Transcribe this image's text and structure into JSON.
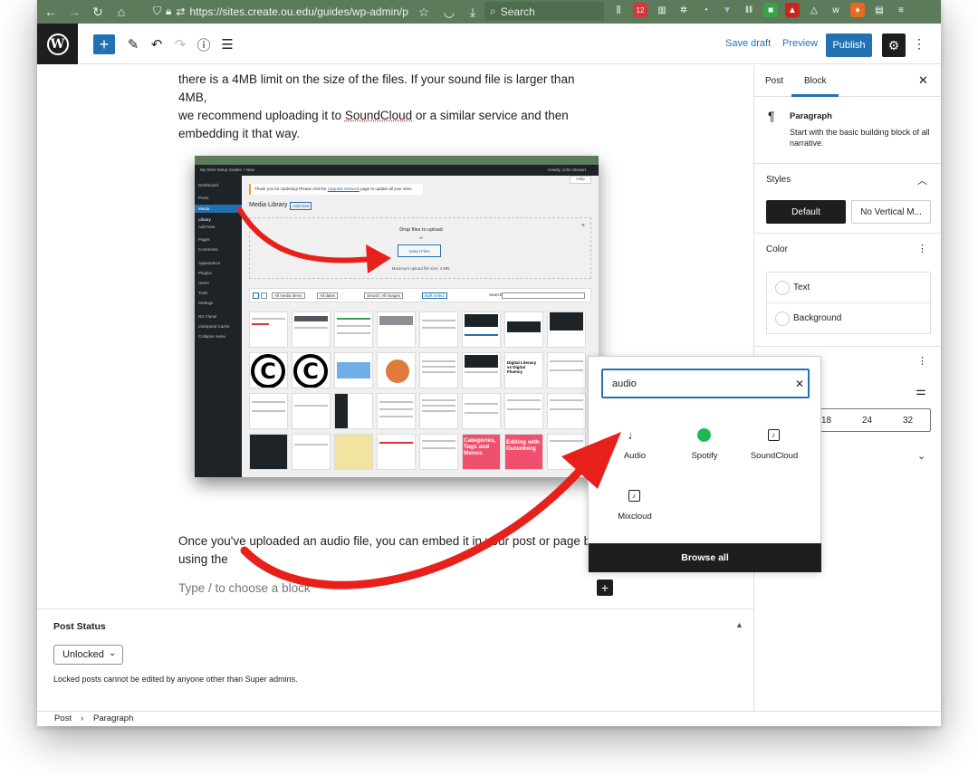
{
  "browser": {
    "url": "https://sites.create.ou.edu/guides/wp-admin/p",
    "search_placeholder": "Search",
    "badge_count": "12"
  },
  "toolbar": {
    "save_draft": "Save draft",
    "preview": "Preview",
    "publish": "Publish"
  },
  "editor": {
    "intro_line1": "there is a 4MB limit on the size of the files. If your sound file is larger than 4MB,",
    "intro_line2_pre": "we recommend uploading it to ",
    "intro_link": "SoundCloud",
    "intro_line2_post": " or a similar service and then",
    "intro_line3": "embedding it that way.",
    "embed_line1": "Once you've uploaded an audio file, you can embed it in your post or page by",
    "embed_line2": "using the",
    "placeholder": "Type / to choose a block"
  },
  "screenshot": {
    "menu": [
      "Dashboard",
      "Posts",
      "Media",
      "Library",
      "Add New",
      "Pages",
      "Comments",
      "Appearance",
      "Plugins",
      "Users",
      "Tools",
      "Settings",
      "NS Cloner",
      "LiteSpeed Cache",
      "Collapse menu"
    ],
    "admin_bar": "My Sites   Setup Guides   + New",
    "howdy": "Howdy, John Stewart",
    "notice_pre": "Thank you for Updating! Please visit the ",
    "notice_link": "Upgrade Network",
    "notice_post": " page to update all your sites.",
    "title": "Media Library",
    "add_new": "Add New",
    "help": "Help",
    "drop_title": "Drop files to upload",
    "drop_or": "or",
    "select_files": "Select Files",
    "max_size": "Maximum upload file size: 4 MB.",
    "filter_items": "All media items",
    "filter_dates": "All dates",
    "filter_smush": "Smush: All images",
    "bulk_select": "Bulk select",
    "search_label": "Search",
    "tile_text_1": "Categories, Tags and Menus",
    "tile_text_2": "Editing with Gutenberg",
    "tile_text_3": "Digital Literacy vs Digital Fluency"
  },
  "post_status": {
    "title": "Post Status",
    "lock_value": "Unlocked",
    "help": "Locked posts cannot be edited by anyone other than Super admins."
  },
  "breadcrumb": {
    "root": "Post",
    "separator": "›",
    "current": "Paragraph"
  },
  "sidebar": {
    "tab_post": "Post",
    "tab_block": "Block",
    "block_name": "Paragraph",
    "block_desc": "Start with the basic building block of all narrative.",
    "styles_title": "Styles",
    "style_default": "Default",
    "style_novertical": "No Vertical M...",
    "color_title": "Color",
    "color_text": "Text",
    "color_background": "Background",
    "font_sizes": [
      "18",
      "24",
      "32"
    ]
  },
  "inserter": {
    "search_value": "audio",
    "items": [
      {
        "label": "Audio",
        "icon": "audio-note-icon"
      },
      {
        "label": "Spotify",
        "icon": "spotify-icon"
      },
      {
        "label": "SoundCloud",
        "icon": "soundcloud-icon"
      },
      {
        "label": "Mixcloud",
        "icon": "mixcloud-icon"
      }
    ],
    "browse_all": "Browse all"
  },
  "colors": {
    "accent": "#2271b1",
    "dark": "#1e1e1e",
    "browser_green": "#5b7b5b",
    "annotation_red": "#e8201b"
  }
}
